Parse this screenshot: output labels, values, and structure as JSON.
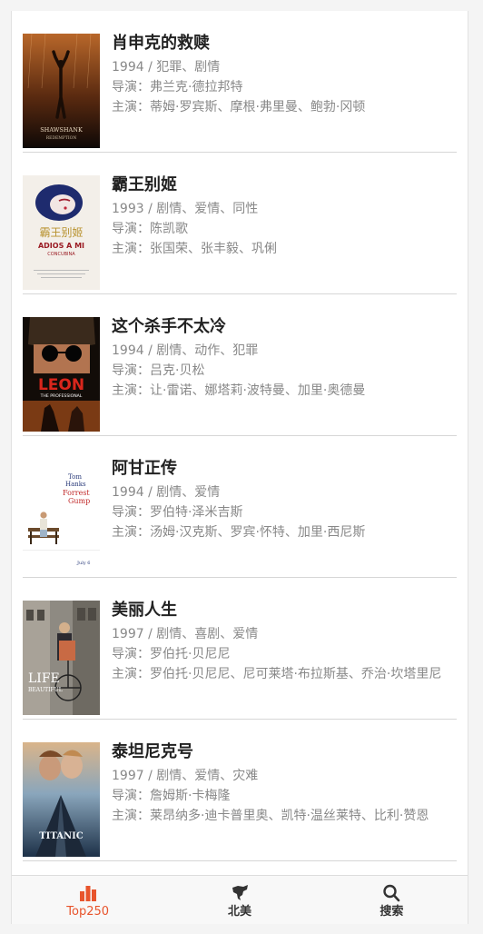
{
  "colors": {
    "accent": "#e8542c",
    "title": "#222222",
    "meta": "#888888",
    "divider": "#d6d6d6"
  },
  "movies": [
    {
      "title": "肖申克的救赎",
      "info": "1994 / 犯罪、剧情",
      "director": "导演：弗兰克·德拉邦特",
      "cast": "主演：蒂姆·罗宾斯、摩根·弗里曼、鲍勃·冈顿",
      "poster": {
        "line1": "SHAWSHANK",
        "line2": "REDEMPTION"
      }
    },
    {
      "title": "霸王别姬",
      "info": "1993 / 剧情、爱情、同性",
      "director": "导演：陈凯歌",
      "cast": "主演：张国荣、张丰毅、巩俐",
      "poster": {
        "line1": "ADIOS A MI",
        "line2": "CONCUBINA",
        "calligraphy": "霸王别姬"
      }
    },
    {
      "title": "这个杀手不太冷",
      "info": "1994 / 剧情、动作、犯罪",
      "director": "导演：吕克·贝松",
      "cast": "主演：让·雷诺、娜塔莉·波特曼、加里·奥德曼",
      "poster": {
        "line1": "LEON",
        "line2": "THE PROFESSIONAL"
      }
    },
    {
      "title": "阿甘正传",
      "info": "1994 / 剧情、爱情",
      "director": "导演：罗伯特·泽米吉斯",
      "cast": "主演：汤姆·汉克斯、罗宾·怀特、加里·西尼斯",
      "poster": {
        "line1": "Tom",
        "line2": "Hanks",
        "line3": "Forrest",
        "line4": "Gump",
        "line5": "July 6"
      }
    },
    {
      "title": "美丽人生",
      "info": "1997 / 剧情、喜剧、爱情",
      "director": "导演：罗伯托·贝尼尼",
      "cast": "主演：罗伯托·贝尼尼、尼可莱塔·布拉斯基、乔治·坎塔里尼",
      "poster": {
        "line1": "LIFE",
        "line2": "BEAUTIFUL"
      }
    },
    {
      "title": "泰坦尼克号",
      "info": "1997 / 剧情、爱情、灾难",
      "director": "导演：詹姆斯·卡梅隆",
      "cast": "主演：莱昂纳多·迪卡普里奥、凯特·温丝莱特、比利·赞恩",
      "poster": {
        "line1": "TITANIC"
      }
    }
  ],
  "tabs": [
    {
      "label": "Top250",
      "icon": "bar-chart-icon",
      "active": true
    },
    {
      "label": "北美",
      "icon": "north-america-icon",
      "active": false
    },
    {
      "label": "搜索",
      "icon": "search-icon",
      "active": false
    }
  ]
}
